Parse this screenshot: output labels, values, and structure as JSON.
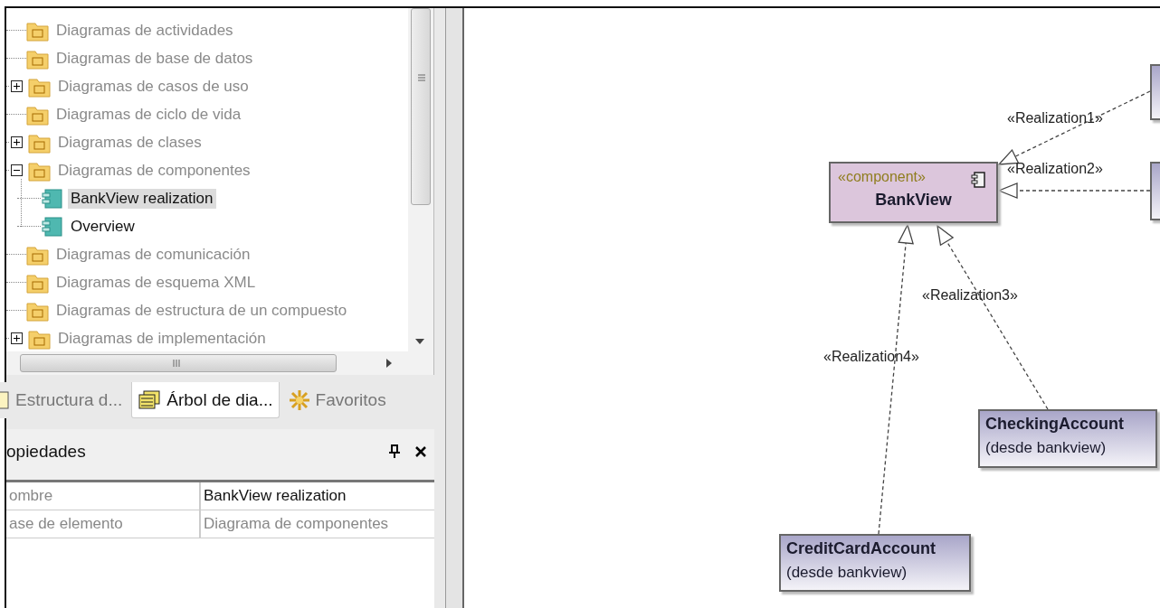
{
  "tree": {
    "items": [
      {
        "label": "Diagramas de actividades",
        "kind": "folder"
      },
      {
        "label": "Diagramas de base de datos",
        "kind": "folder"
      },
      {
        "label": "Diagramas de casos de uso",
        "kind": "folder",
        "expanded": false
      },
      {
        "label": "Diagramas de ciclo de vida",
        "kind": "folder"
      },
      {
        "label": "Diagramas de clases",
        "kind": "folder",
        "expanded": false
      },
      {
        "label": "Diagramas de componentes",
        "kind": "folder",
        "expanded": true,
        "children": [
          {
            "label": "BankView realization",
            "kind": "diagram",
            "selected": true
          },
          {
            "label": "Overview",
            "kind": "diagram",
            "selected": false
          }
        ]
      },
      {
        "label": "Diagramas de comunicación",
        "kind": "folder"
      },
      {
        "label": "Diagramas de esquema XML",
        "kind": "folder"
      },
      {
        "label": "Diagramas de estructura de un compuesto",
        "kind": "folder"
      },
      {
        "label": "Diagramas de implementación",
        "kind": "folder",
        "expanded": false
      }
    ]
  },
  "tabs": [
    {
      "label": "Estructura d...",
      "selected": false
    },
    {
      "label": "Árbol de dia...",
      "selected": true
    },
    {
      "label": "Favoritos",
      "selected": false
    }
  ],
  "properties": {
    "title": "opiedades",
    "rows": [
      {
        "name": "ombre",
        "value": "BankView realization",
        "readonly": false
      },
      {
        "name": "ase de elemento",
        "value": "Diagrama de componentes",
        "readonly": true
      }
    ]
  },
  "diagram": {
    "nodes": [
      {
        "kind": "partial"
      },
      {
        "kind": "partial"
      },
      {
        "kind": "component",
        "stereotype": "«component»",
        "name": "BankView"
      },
      {
        "kind": "class",
        "name": "CheckingAccount",
        "subtitle": "(desde bankview)"
      },
      {
        "kind": "class",
        "name": "CreditCardAccount",
        "subtitle": "(desde bankview)"
      }
    ],
    "edges": [
      {
        "label": "«Realization1»"
      },
      {
        "label": "«Realization2»"
      },
      {
        "label": "«Realization3»"
      },
      {
        "label": "«Realization4»"
      }
    ]
  }
}
